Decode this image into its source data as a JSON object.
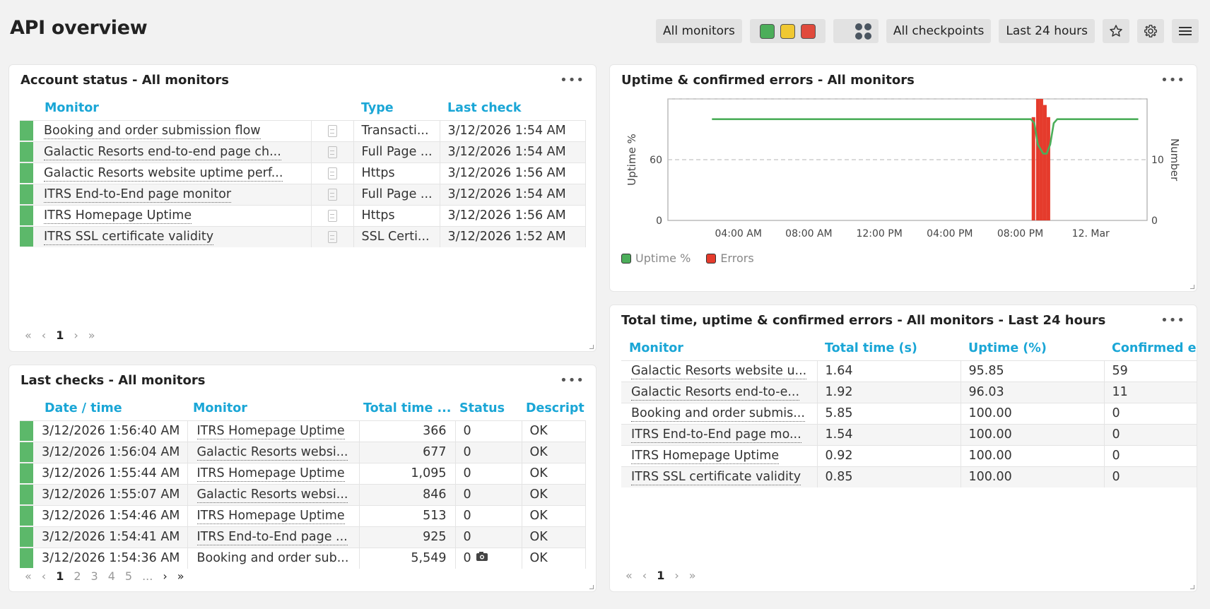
{
  "page": {
    "title": "API overview"
  },
  "toolbar": {
    "monitors": "All monitors",
    "checkpoints": "All checkpoints",
    "period": "Last 24 hours",
    "status_colors": [
      "#4cae5a",
      "#f0c832",
      "#e04a3c"
    ]
  },
  "account_status": {
    "title": "Account status - All monitors",
    "columns": {
      "monitor": "Monitor",
      "type": "Type",
      "last_check": "Last check"
    },
    "rows": [
      {
        "monitor": "Booking and order submission flow",
        "type": "Transacti...",
        "last_check": "3/12/2026 1:54 AM"
      },
      {
        "monitor": "Galactic Resorts end-to-end page ch...",
        "type": "Full Page ...",
        "last_check": "3/12/2026 1:54 AM"
      },
      {
        "monitor": "Galactic Resorts website uptime perf...",
        "type": "Https",
        "last_check": "3/12/2026 1:56 AM"
      },
      {
        "monitor": "ITRS End-to-End page monitor",
        "type": "Full Page ...",
        "last_check": "3/12/2026 1:54 AM"
      },
      {
        "monitor": "ITRS Homepage Uptime",
        "type": "Https",
        "last_check": "3/12/2026 1:56 AM"
      },
      {
        "monitor": "ITRS SSL certificate validity",
        "type": "SSL Certi...",
        "last_check": "3/12/2026 1:52 AM"
      }
    ],
    "pager": {
      "first": "«",
      "prev": "‹",
      "current": "1",
      "next": "›",
      "last": "»"
    }
  },
  "last_checks": {
    "title": "Last checks - All monitors",
    "columns": {
      "datetime": "Date / time",
      "monitor": "Monitor",
      "total_time": "Total time ...",
      "status": "Status",
      "description": "Descripti"
    },
    "rows": [
      {
        "datetime": "3/12/2026 1:56:40 AM",
        "monitor": "ITRS Homepage Uptime",
        "total_time": "366",
        "status": "0",
        "description": "OK",
        "camera": false
      },
      {
        "datetime": "3/12/2026 1:56:04 AM",
        "monitor": "Galactic Resorts websi...",
        "total_time": "677",
        "status": "0",
        "description": "OK",
        "camera": false
      },
      {
        "datetime": "3/12/2026 1:55:44 AM",
        "monitor": "ITRS Homepage Uptime",
        "total_time": "1,095",
        "status": "0",
        "description": "OK",
        "camera": false
      },
      {
        "datetime": "3/12/2026 1:55:07 AM",
        "monitor": "Galactic Resorts websi...",
        "total_time": "846",
        "status": "0",
        "description": "OK",
        "camera": false
      },
      {
        "datetime": "3/12/2026 1:54:46 AM",
        "monitor": "ITRS Homepage Uptime",
        "total_time": "513",
        "status": "0",
        "description": "OK",
        "camera": false
      },
      {
        "datetime": "3/12/2026 1:54:41 AM",
        "monitor": "ITRS End-to-End page ...",
        "total_time": "925",
        "status": "0",
        "description": "OK",
        "camera": false
      },
      {
        "datetime": "3/12/2026 1:54:36 AM",
        "monitor": "Booking and order sub...",
        "total_time": "5,549",
        "status": "0",
        "description": "OK",
        "camera": true
      }
    ],
    "pager": {
      "first": "«",
      "prev": "‹",
      "pages": [
        "1",
        "2",
        "3",
        "4",
        "5",
        "..."
      ],
      "next": "›",
      "last": "»"
    }
  },
  "uptime_chart": {
    "title": "Uptime & confirmed errors - All monitors",
    "legend": {
      "uptime": "Uptime %",
      "errors": "Errors"
    },
    "colors": {
      "uptime": "#4cae5a",
      "errors": "#e53b2c"
    }
  },
  "chart_data": {
    "type": "line",
    "x": [
      "04:00 AM",
      "08:00 AM",
      "12:00 PM",
      "04:00 PM",
      "08:00 PM",
      "12. Mar"
    ],
    "xlabel": "",
    "ylabel": "Uptime %",
    "ylabel_right": "Number",
    "yticks_left": [
      "0",
      "60"
    ],
    "yticks_right": [
      "0",
      "10"
    ],
    "ylim": [
      0,
      120
    ],
    "ylim_right": [
      0,
      20
    ],
    "grid": true,
    "legend_position": "bottom-left",
    "series": [
      {
        "name": "Uptime %",
        "type": "line",
        "points": [
          [
            2.5,
            100
          ],
          [
            20.6,
            100
          ],
          [
            20.8,
            96
          ],
          [
            21.0,
            75
          ],
          [
            21.3,
            66
          ],
          [
            21.5,
            66
          ],
          [
            21.7,
            75
          ],
          [
            21.9,
            96
          ],
          [
            22.1,
            100
          ],
          [
            26.7,
            100
          ]
        ]
      },
      {
        "name": "Errors",
        "type": "bar",
        "points": [
          [
            20.75,
            17
          ],
          [
            21.0,
            20
          ],
          [
            21.2,
            20
          ],
          [
            21.4,
            19
          ],
          [
            21.6,
            17
          ]
        ]
      }
    ]
  },
  "totals": {
    "title": "Total time, uptime & confirmed errors - All monitors - Last 24 hours",
    "columns": {
      "monitor": "Monitor",
      "total_time": "Total time (s)",
      "uptime": "Uptime (%)",
      "errors": "Confirmed er"
    },
    "rows": [
      {
        "monitor": "Galactic Resorts website u...",
        "total_time": "1.64",
        "uptime": "95.85",
        "errors": "59"
      },
      {
        "monitor": "Galactic Resorts end-to-e...",
        "total_time": "1.92",
        "uptime": "96.03",
        "errors": "11"
      },
      {
        "monitor": "Booking and order submis...",
        "total_time": "5.85",
        "uptime": "100.00",
        "errors": "0"
      },
      {
        "monitor": "ITRS End-to-End page mo...",
        "total_time": "1.54",
        "uptime": "100.00",
        "errors": "0"
      },
      {
        "monitor": "ITRS Homepage Uptime",
        "total_time": "0.92",
        "uptime": "100.00",
        "errors": "0"
      },
      {
        "monitor": "ITRS SSL certificate validity",
        "total_time": "0.85",
        "uptime": "100.00",
        "errors": "0"
      }
    ],
    "pager": {
      "first": "«",
      "prev": "‹",
      "current": "1",
      "next": "›",
      "last": "»"
    }
  }
}
